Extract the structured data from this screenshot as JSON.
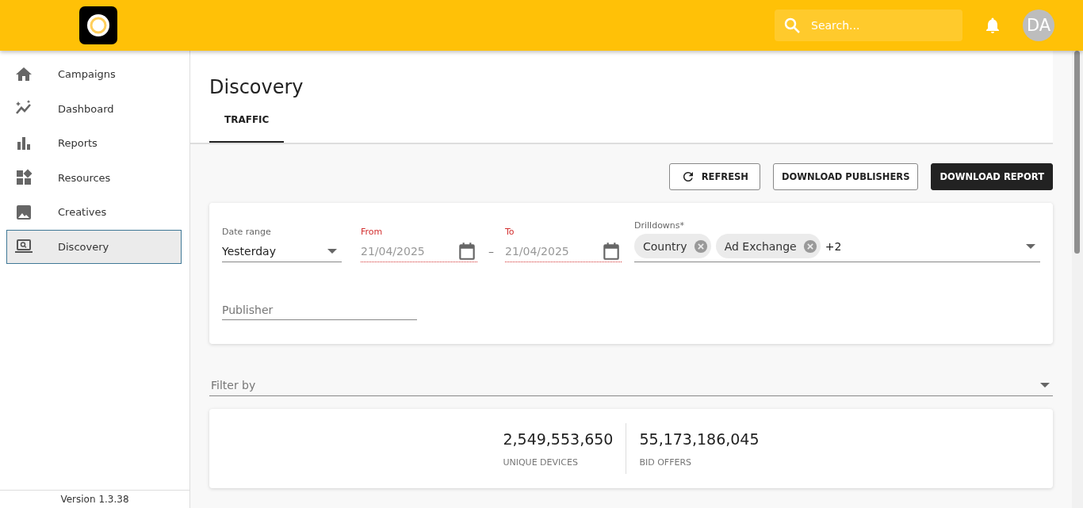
{
  "header": {
    "search": {
      "placeholder": "Search..."
    },
    "avatar": "DA"
  },
  "sidebar": {
    "items": [
      {
        "label": "Campaigns",
        "selected": false
      },
      {
        "label": "Dashboard",
        "selected": false
      },
      {
        "label": "Reports",
        "selected": false
      },
      {
        "label": "Resources",
        "selected": false
      },
      {
        "label": "Creatives",
        "selected": false
      },
      {
        "label": "Discovery",
        "selected": true
      }
    ],
    "version": "Version 1.3.38"
  },
  "page": {
    "title": "Discovery",
    "tabs": [
      {
        "label": "TRAFFIC",
        "selected": true
      }
    ]
  },
  "actions": [
    {
      "label": "REFRESH",
      "kind": "refresh"
    },
    {
      "label": "DOWNLOAD PUBLISHERS",
      "kind": "outline"
    },
    {
      "label": "DOWNLOAD REPORT",
      "kind": "primary"
    }
  ],
  "form": {
    "date_range": {
      "label": "Date range",
      "value": "Yesterday"
    },
    "from": {
      "label": "From",
      "value": "21/04/2025",
      "error": true
    },
    "separator": "–",
    "to": {
      "label": "To",
      "value": "21/04/2025",
      "error": true
    },
    "drilldowns": {
      "label": "Drilldowns*",
      "chips": [
        "Country",
        "Ad Exchange"
      ],
      "more": "+2"
    },
    "publisher": {
      "placeholder": "Publisher"
    }
  },
  "filter": {
    "placeholder": "Filter by"
  },
  "stats": [
    {
      "value": "2,549,553,650",
      "label": "UNIQUE DEVICES"
    },
    {
      "value": "55,173,186,045",
      "label": "BID OFFERS"
    }
  ]
}
